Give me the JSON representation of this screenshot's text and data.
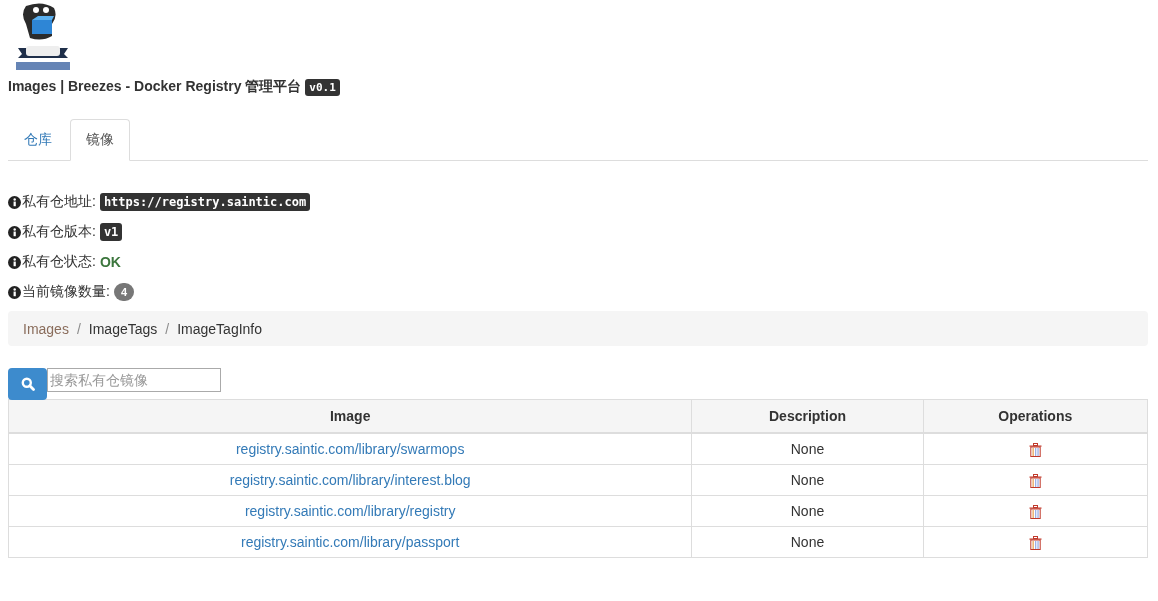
{
  "header": {
    "title": "Images | Breezes - Docker Registry 管理平台",
    "version": "v0.1"
  },
  "tabs": [
    {
      "label": "仓库",
      "selected": false
    },
    {
      "label": "镜像",
      "selected": true
    }
  ],
  "info": [
    {
      "label": "私有仓地址:",
      "value": "https://registry.saintic.com",
      "kind": "code"
    },
    {
      "label": "私有仓版本:",
      "value": "v1",
      "kind": "code"
    },
    {
      "label": "私有仓状态:",
      "value": "OK",
      "kind": "status"
    },
    {
      "label": "当前镜像数量:",
      "value": "4",
      "kind": "count"
    }
  ],
  "breadcrumb": [
    {
      "label": "Images",
      "active": true
    },
    {
      "separator": "/",
      "label": "ImageTags",
      "active": false
    },
    {
      "separator": "/",
      "label": "ImageTagInfo",
      "active": false
    }
  ],
  "search": {
    "placeholder": "搜索私有仓镜像"
  },
  "table": {
    "columns": [
      "Image",
      "Description",
      "Operations"
    ],
    "rows": [
      {
        "image": "registry.saintic.com/library/swarmops",
        "description": "None"
      },
      {
        "image": "registry.saintic.com/library/interest.blog",
        "description": "None"
      },
      {
        "image": "registry.saintic.com/library/registry",
        "description": "None"
      },
      {
        "image": "registry.saintic.com/library/passport",
        "description": "None"
      }
    ]
  }
}
